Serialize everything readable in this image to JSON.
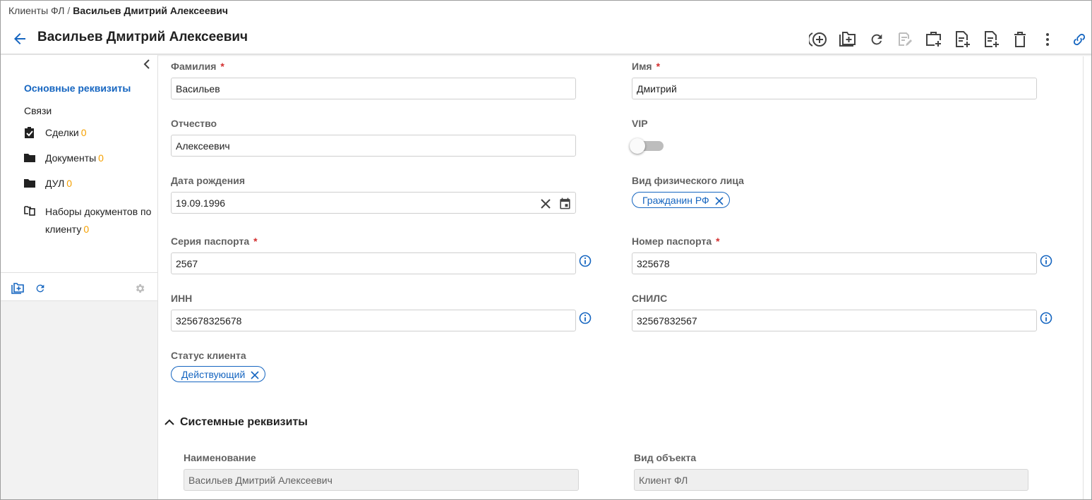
{
  "breadcrumb": {
    "parent": "Клиенты ФЛ",
    "separator": "/",
    "current": "Васильев Дмитрий Алексеевич"
  },
  "header": {
    "title": "Васильев Дмитрий Алексеевич"
  },
  "toolbar": {
    "icons": [
      "add-circle-icon",
      "add-folder-icon",
      "refresh-icon",
      "edit-document-icon",
      "add-briefcase-icon",
      "add-document-icon",
      "add-document-alt-icon",
      "delete-icon",
      "more-vertical-icon",
      "link-icon"
    ]
  },
  "sidebar": {
    "items": [
      {
        "label": "Основные реквизиты",
        "active": true
      },
      {
        "label": "Связи"
      },
      {
        "label": "Сделки",
        "count": "0",
        "icon": "clipboard-check-icon"
      },
      {
        "label": "Документы",
        "count": "0",
        "icon": "folder-icon"
      },
      {
        "label": "ДУЛ",
        "count": "0",
        "icon": "folder-icon"
      },
      {
        "label": "Наборы документов по",
        "label2": "клиенту",
        "count": "0",
        "icon": "document-set-icon"
      }
    ],
    "tools": [
      "add-folder-icon",
      "refresh-icon",
      "settings-icon"
    ]
  },
  "form": {
    "last_name": {
      "label": "Фамилия",
      "required": "*",
      "value": "Васильев"
    },
    "first_name": {
      "label": "Имя",
      "required": "*",
      "value": "Дмитрий"
    },
    "middle_name": {
      "label": "Отчество",
      "value": "Алексеевич"
    },
    "vip": {
      "label": "VIP",
      "enabled": false
    },
    "birth_date": {
      "label": "Дата рождения",
      "value": "19.09.1996"
    },
    "person_type": {
      "label": "Вид физического лица",
      "chip": "Гражданин РФ"
    },
    "passport_series": {
      "label": "Серия паспорта",
      "required": "*",
      "value": "2567"
    },
    "passport_number": {
      "label": "Номер паспорта",
      "required": "*",
      "value": "325678"
    },
    "inn": {
      "label": "ИНН",
      "value": "325678325678"
    },
    "snils": {
      "label": "СНИЛС",
      "value": "32567832567"
    },
    "client_status": {
      "label": "Статус клиента",
      "chip": "Действующий"
    }
  },
  "system_section": {
    "title": "Системные реквизиты",
    "name": {
      "label": "Наименование",
      "value": "Васильев Дмитрий Алексеевич"
    },
    "object_type": {
      "label": "Вид объекта",
      "value": "Клиент ФЛ"
    }
  },
  "colors": {
    "accent": "#1565c0",
    "required": "#d32f2f",
    "count": "#f5a000",
    "label": "#616161"
  }
}
